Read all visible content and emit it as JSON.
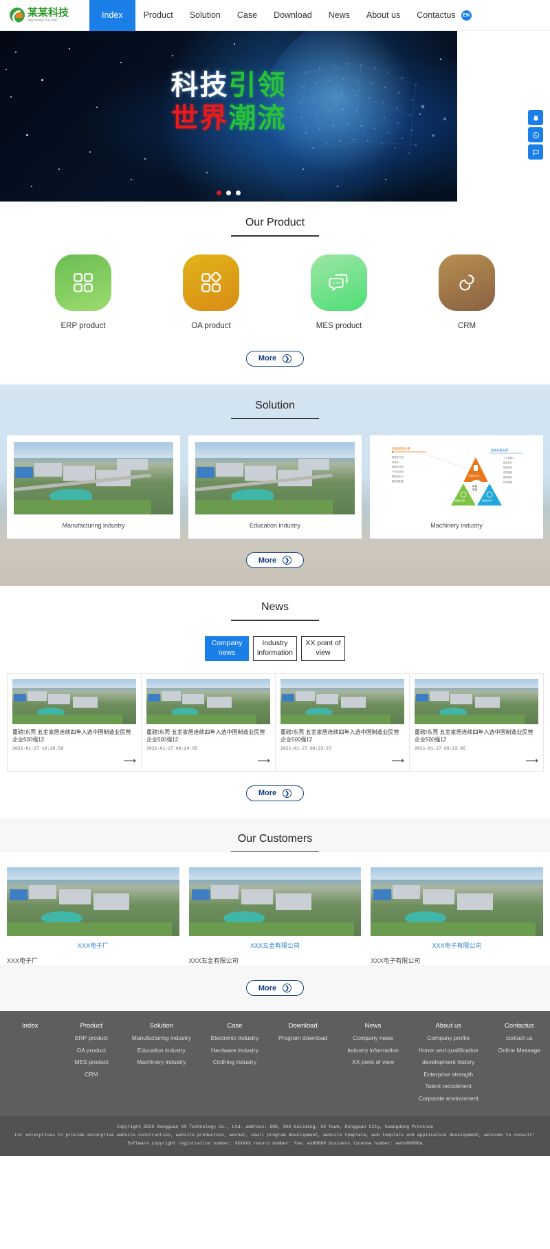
{
  "header": {
    "logo": {
      "name": "某某科技",
      "url": "http://www.xxx.com"
    },
    "nav": [
      {
        "label": "Index",
        "active": true
      },
      {
        "label": "Product",
        "active": false
      },
      {
        "label": "Solution",
        "active": false
      },
      {
        "label": "Case",
        "active": false
      },
      {
        "label": "Download",
        "active": false
      },
      {
        "label": "News",
        "active": false
      },
      {
        "label": "About us",
        "active": false
      },
      {
        "label": "Contactus",
        "active": false
      }
    ],
    "language_badge": "EN"
  },
  "hero": {
    "line1_a": "科技",
    "line1_b": "引领",
    "line2_a": "世界",
    "line2_b": "潮流",
    "dots": 3,
    "active_dot": 0,
    "side_tools": [
      {
        "name": "notification-icon",
        "glyph": "🔔"
      },
      {
        "name": "phone-icon",
        "glyph": "✆"
      },
      {
        "name": "message-icon",
        "glyph": "💬"
      }
    ]
  },
  "product_section": {
    "title": "Our Product",
    "items": [
      {
        "label": "ERP product",
        "icon": "grid-four-squares-icon",
        "color": "#6bbd53"
      },
      {
        "label": "OA product",
        "icon": "grid-diamond-icon",
        "color": "#e0b418"
      },
      {
        "label": "MES product",
        "icon": "chat-bubbles-icon",
        "color": "#4ede76"
      },
      {
        "label": "CRM",
        "icon": "link-loop-icon",
        "color": "#b79050"
      }
    ],
    "more_label": "More"
  },
  "solution_section": {
    "title": "Solution",
    "cards": [
      {
        "caption": "Manufacturing industry",
        "type": "photo"
      },
      {
        "caption": "Education industry",
        "type": "photo"
      },
      {
        "caption": "Machinery industry",
        "type": "diagram"
      }
    ],
    "more_label": "More"
  },
  "news_section": {
    "title": "News",
    "tabs": [
      {
        "label": "Company news",
        "active": true
      },
      {
        "label": "Industry information",
        "active": false
      },
      {
        "label": "XX point of view",
        "active": false
      }
    ],
    "cards": [
      {
        "title": "重磅!东莞 五金家居连续四年入选中国制造业民营企业500强12",
        "date": "2021-01-27 10:38:58"
      },
      {
        "title": "重磅!东莞 五金家居连续四年入选中国制造业民营企业500强12",
        "date": "2021-01-27 09:24:05"
      },
      {
        "title": "重磅!东莞 五金家居连续四年入选中国制造业民营企业500强12",
        "date": "2021-01-27 09:23:27"
      },
      {
        "title": "重磅!东莞 五金家居连续四年入选中国制造业民营企业500强12",
        "date": "2021-01-27 09:23:05"
      }
    ],
    "arrow": "⟶",
    "more_label": "More"
  },
  "customers_section": {
    "title": "Our Customers",
    "cards": [
      {
        "link": "XXX电子厂",
        "name": "XXX电子厂"
      },
      {
        "link": "XXX五金有限公司",
        "name": "XXX五金有限公司"
      },
      {
        "link": "XXX电子有限公司",
        "name": "XXX电子有限公司"
      }
    ],
    "more_label": "More"
  },
  "footer": {
    "columns": [
      {
        "head": "Index",
        "links": []
      },
      {
        "head": "Product",
        "links": [
          "ERP product",
          "OA product",
          "MES product",
          "CRM"
        ]
      },
      {
        "head": "Solution",
        "links": [
          "Manufacturing industry",
          "Education industry",
          "Machinery industry"
        ]
      },
      {
        "head": "Case",
        "links": [
          "Electronic industry",
          "Hardware industry",
          "Clothing industry"
        ]
      },
      {
        "head": "Download",
        "links": [
          "Program download"
        ]
      },
      {
        "head": "News",
        "links": [
          "Company news",
          "Industry information",
          "XX point of view"
        ]
      },
      {
        "head": "About us",
        "links": [
          "Company profile",
          "Honor and qualification",
          "development history",
          "Enterprise strength",
          "Talent recruitment",
          "Corporate environment"
        ]
      },
      {
        "head": "Contactus",
        "links": [
          "contact us",
          "Online Message"
        ]
      }
    ],
    "copyright": [
      "Copyright 2020 Dongguan XX Technology Co., Ltd. address: 888, XXX building, XX town, Dongguan City, Guangdong Province",
      "For enterprises to provide enterprise website construction, website production, wechat, small program development, website template, web template and application development, welcome to consult!",
      "Software copyright registration number: XXXXXX record number: Yue: wx88888 business license number: webs88888a"
    ]
  }
}
